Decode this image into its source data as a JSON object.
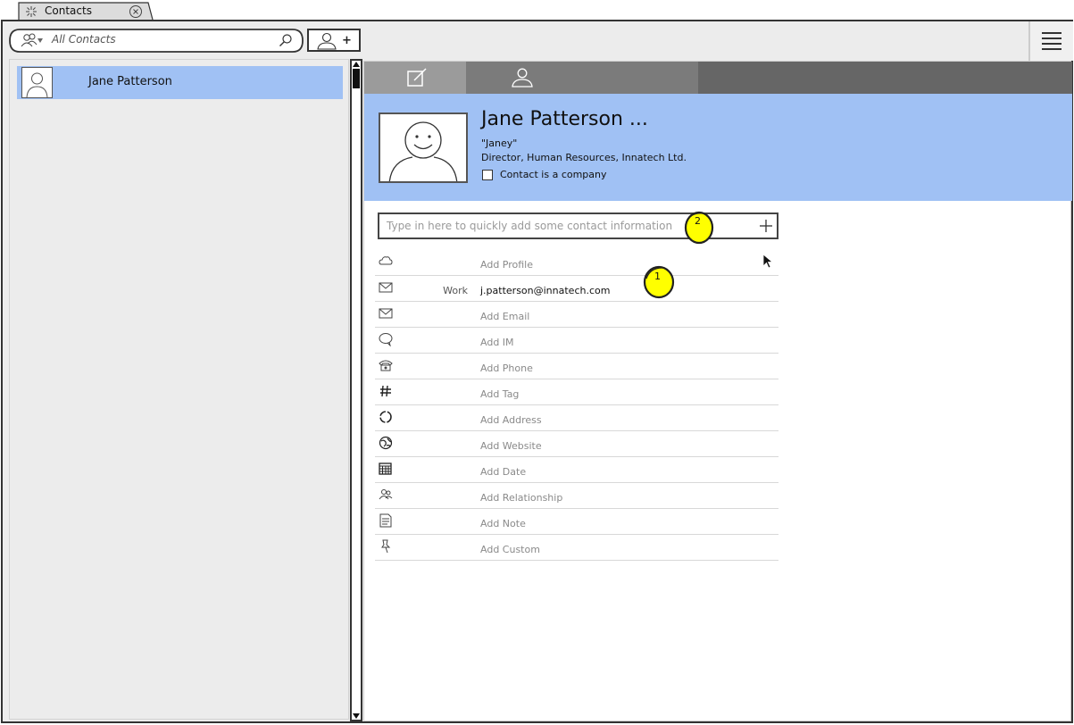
{
  "tab": {
    "label": "Contacts",
    "icon": "sparkle-icon",
    "close_icon": "close-circle-icon"
  },
  "toolbar": {
    "search_placeholder": "All Contacts",
    "filter_icon": "people-filter-icon",
    "search_icon": "magnifier-icon",
    "add_contact_label": "+",
    "menu_icon": "hamburger-icon"
  },
  "contact_list": [
    {
      "name": "Jane Patterson",
      "selected": true
    }
  ],
  "details": {
    "tabs": [
      {
        "name": "edit",
        "icon": "edit-icon",
        "active": true
      },
      {
        "name": "person",
        "icon": "person-icon",
        "active": false
      }
    ],
    "name": "Jane Patterson ...",
    "nickname": "\"Janey\"",
    "job": "Director, Human Resources, Innatech Ltd.",
    "company_checkbox_label": "Contact is a company",
    "company_checked": false,
    "quick_add_placeholder": "Type in here to quickly add some contact information",
    "quick_add_icon": "plus-icon",
    "fields": [
      {
        "icon": "cloud-icon",
        "label": "",
        "text": "Add Profile",
        "is_value": false
      },
      {
        "icon": "envelope-icon",
        "label": "Work",
        "text": "j.patterson@innatech.com",
        "is_value": true
      },
      {
        "icon": "envelope-icon",
        "label": "",
        "text": "Add Email",
        "is_value": false
      },
      {
        "icon": "chat-bubble-icon",
        "label": "",
        "text": "Add IM",
        "is_value": false
      },
      {
        "icon": "telephone-icon",
        "label": "",
        "text": "Add Phone",
        "is_value": false
      },
      {
        "icon": "hash-icon",
        "label": "",
        "text": "Add Tag",
        "is_value": false
      },
      {
        "icon": "location-circle-icon",
        "label": "",
        "text": "Add Address",
        "is_value": false
      },
      {
        "icon": "globe-icon",
        "label": "",
        "text": "Add Website",
        "is_value": false
      },
      {
        "icon": "calendar-icon",
        "label": "",
        "text": "Add Date",
        "is_value": false
      },
      {
        "icon": "relationship-icon",
        "label": "",
        "text": "Add Relationship",
        "is_value": false
      },
      {
        "icon": "note-icon",
        "label": "",
        "text": "Add Note",
        "is_value": false
      },
      {
        "icon": "pin-icon",
        "label": "",
        "text": "Add Custom",
        "is_value": false
      }
    ]
  },
  "annotations": [
    {
      "number": "1",
      "color": "#ffff00"
    },
    {
      "number": "2",
      "color": "#ffff00"
    }
  ]
}
